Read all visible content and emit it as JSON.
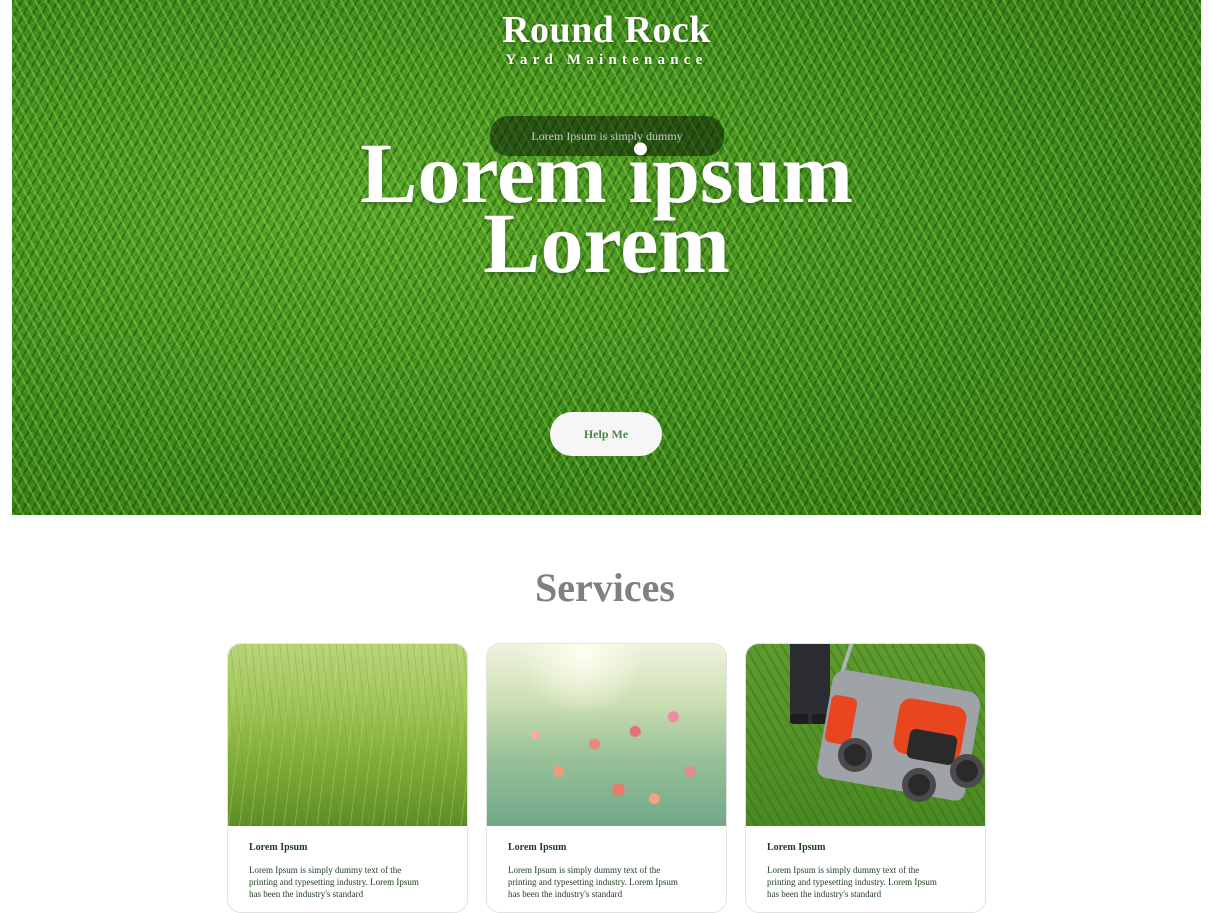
{
  "hero": {
    "brand_title": "Round Rock",
    "brand_subtitle": "Yard Maintenance",
    "pill_tag": "Lorem Ipsum is simply dummy",
    "headline_line1": "Lorem ipsum",
    "headline_line2": "Lorem",
    "cta_label": "Help Me"
  },
  "services": {
    "title": "Services",
    "cards": [
      {
        "heading": "Lorem Ipsum",
        "text": "Lorem Ipsum is simply dummy text of the printing and typesetting industry. Lorem Ipsum has been the industry's standard",
        "image": "grass-closeup"
      },
      {
        "heading": "Lorem Ipsum",
        "text": "Lorem Ipsum is simply dummy text of the printing and typesetting industry. Lorem Ipsum has been the industry's standard",
        "image": "flower-garden"
      },
      {
        "heading": "Lorem Ipsum",
        "text": "Lorem Ipsum is simply dummy text of the printing and typesetting industry. Lorem Ipsum has been the industry's standard",
        "image": "lawn-mower"
      }
    ]
  },
  "colors": {
    "brand_green": "#4a8a4a",
    "card_text": "#1c3d1c",
    "section_title": "#808080"
  }
}
